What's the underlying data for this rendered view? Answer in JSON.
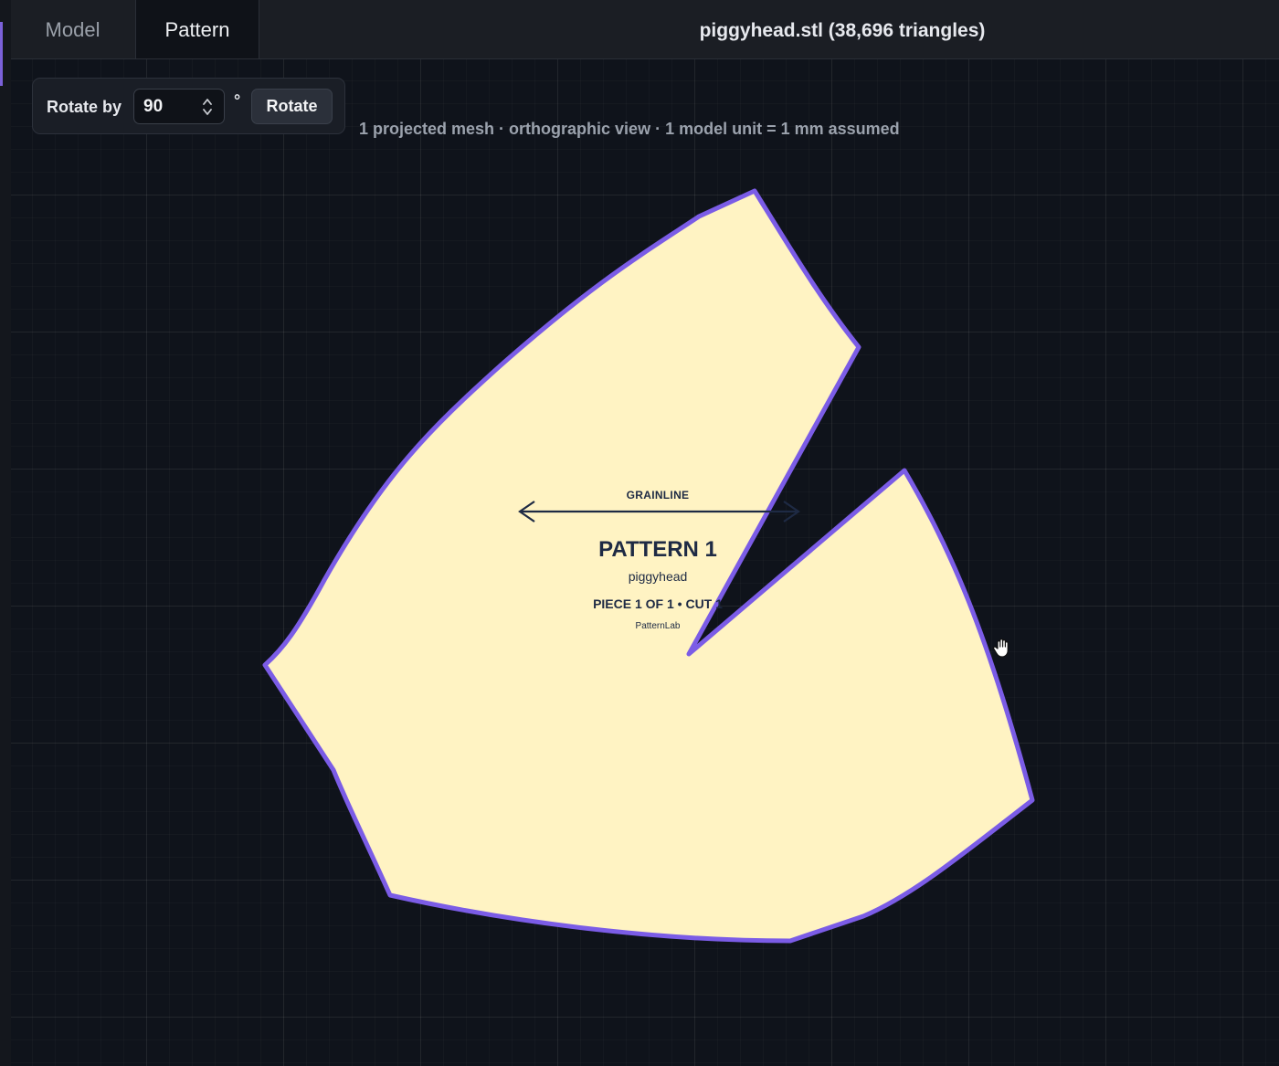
{
  "tabs": [
    {
      "label": "Model",
      "active": false
    },
    {
      "label": "Pattern",
      "active": true
    }
  ],
  "file_title": "piggyhead.stl (38,696 triangles)",
  "rotate_panel": {
    "label": "Rotate by",
    "value": "90",
    "unit": "°",
    "button_label": "Rotate"
  },
  "caption": "1 projected mesh · orthographic view · 1 model unit = 1 mm assumed",
  "pattern_piece": {
    "grainline_label": "GRAINLINE",
    "title": "PATTERN 1",
    "name": "piggyhead",
    "piece_count": "PIECE 1 OF 1 • CUT 1",
    "brand": "PatternLab",
    "fill_color": "#fff3c3",
    "outline_color": "#7b5ce6",
    "grainline_color": "#1e2a44"
  },
  "colors": {
    "background": "#0f131b",
    "topbar": "#1b1e24",
    "accent": "#7b61d9"
  },
  "icons": {
    "stepper": "chevron-up-down-icon",
    "cursor": "hand-grab-icon"
  }
}
